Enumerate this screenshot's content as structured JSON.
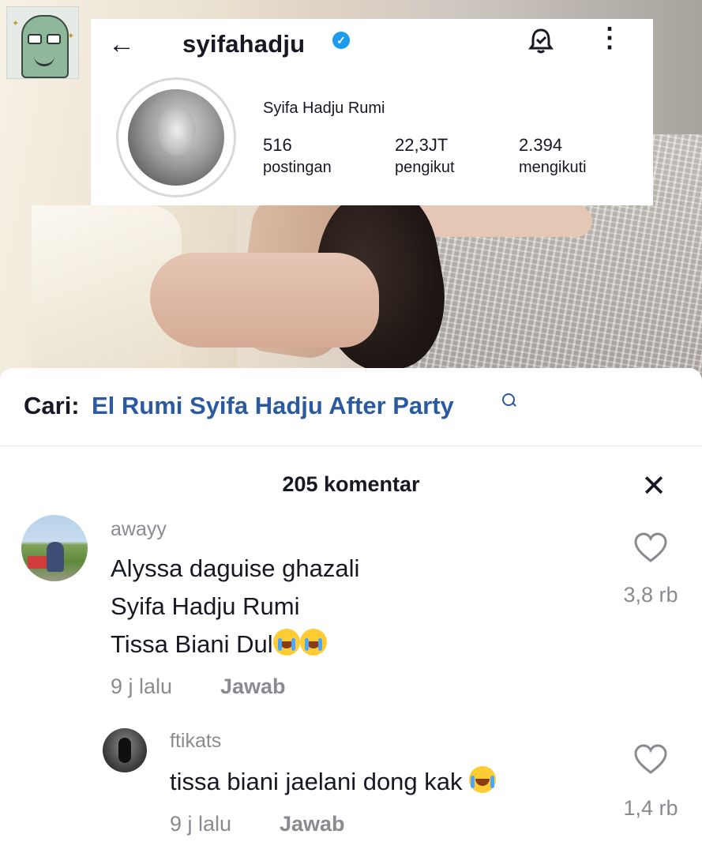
{
  "profile_card": {
    "username": "syifahadju",
    "full_name": "Syifa Hadju Rumi",
    "stats": [
      {
        "value": "516",
        "label": "postingan"
      },
      {
        "value": "22,3JT",
        "label": "pengikut"
      },
      {
        "value": "2.394",
        "label": "mengikuti"
      }
    ]
  },
  "search": {
    "prefix": "Cari:",
    "query": "El Rumi Syifa Hadju After Party"
  },
  "comments_panel": {
    "title": "205 komentar",
    "comments": [
      {
        "user": "awayy",
        "lines": [
          "Alyssa daguise ghazali",
          "Syifa Hadju Rumi",
          "Tissa Biani Dul"
        ],
        "time": "9 j lalu",
        "reply_label": "Jawab",
        "likes": "3,8 rb"
      },
      {
        "user": "ftikats",
        "lines": [
          "tissa biani jaelani dong kak"
        ],
        "time": "9 j lalu",
        "reply_label": "Jawab",
        "likes": "1,4 rb"
      }
    ]
  },
  "colors": {
    "search_link": "#2b5a9e",
    "muted_text": "#8a8b91",
    "verified": "#1d9bf0"
  }
}
